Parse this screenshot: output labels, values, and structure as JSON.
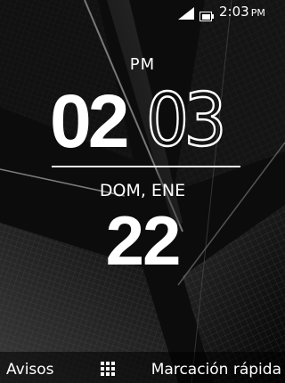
{
  "status_bar": {
    "signal_icon": "signal-icon",
    "battery_icon": "battery-icon",
    "time": "2:03",
    "ampm": "PM"
  },
  "clock": {
    "ampm": "PM",
    "hours": "02",
    "minutes": "03"
  },
  "date": {
    "day_month": "DOM, ENE",
    "day_number": "22"
  },
  "softkeys": {
    "left": "Avisos",
    "center_icon": "apps-grid-icon",
    "right": "Marcación rápida"
  },
  "colors": {
    "text": "#ffffff",
    "background": "#0b0b0b"
  }
}
